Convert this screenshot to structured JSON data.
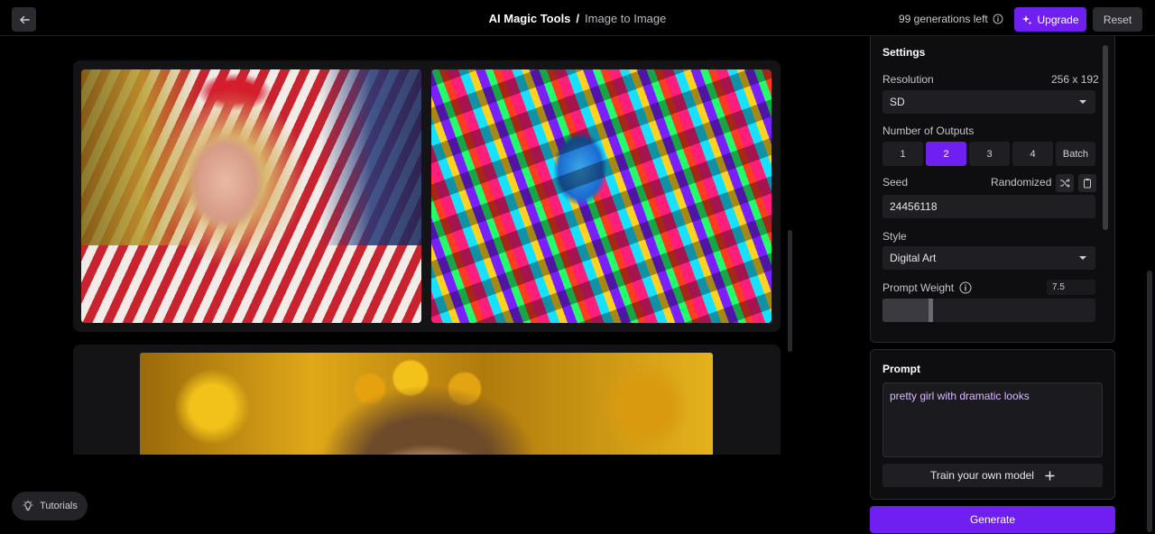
{
  "header": {
    "back_icon": "arrow-left-icon",
    "title": "AI Magic Tools",
    "separator": "/",
    "subtitle": "Image to Image",
    "generations_left": "99 generations left",
    "upgrade_label": "Upgrade",
    "reset_label": "Reset"
  },
  "settings": {
    "heading": "Settings",
    "resolution_label": "Resolution",
    "resolution_value": "256 x 192",
    "resolution_selected": "SD",
    "outputs_label": "Number of Outputs",
    "outputs_options": [
      "1",
      "2",
      "3",
      "4",
      "Batch"
    ],
    "outputs_selected": "2",
    "seed_label": "Seed",
    "seed_mode": "Randomized",
    "seed_value": "24456118",
    "style_label": "Style",
    "style_selected": "Digital Art",
    "prompt_weight_label": "Prompt Weight",
    "prompt_weight_value": "7.5",
    "prompt_weight_fraction": 0.23
  },
  "prompt": {
    "heading": "Prompt",
    "text": "pretty girl with dramatic looks",
    "train_label": "Train your own model",
    "train_icon": "plus-icon"
  },
  "generate_label": "Generate",
  "tutorials_label": "Tutorials",
  "accent_color": "#6f1ff0"
}
